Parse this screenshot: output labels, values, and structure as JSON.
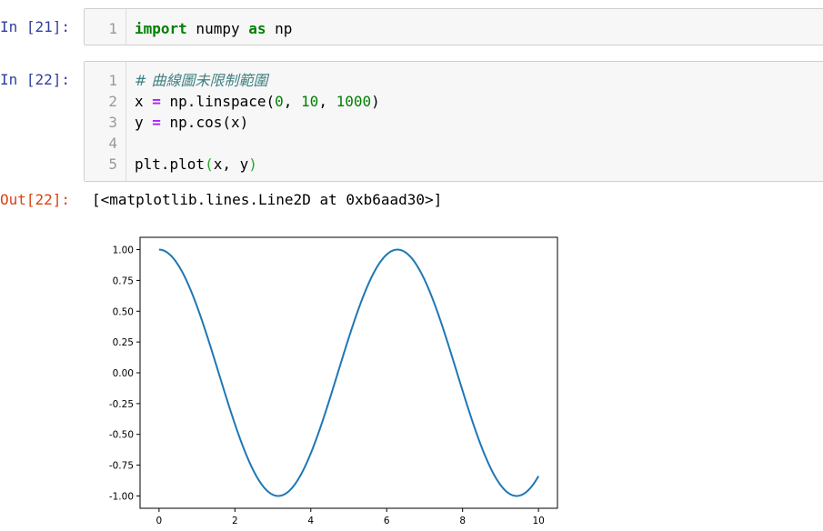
{
  "cells": [
    {
      "prompt": "In [21]:",
      "lines": [
        {
          "n": "1",
          "tokens": [
            {
              "t": "import",
              "c": "kw"
            },
            {
              "t": " numpy ",
              "c": ""
            },
            {
              "t": "as",
              "c": "kw"
            },
            {
              "t": " np",
              "c": ""
            }
          ]
        }
      ]
    },
    {
      "prompt": "In [22]:",
      "lines": [
        {
          "n": "1",
          "tokens": [
            {
              "t": "# 曲線圖未限制範圍",
              "c": "com"
            }
          ]
        },
        {
          "n": "2",
          "tokens": [
            {
              "t": "x ",
              "c": ""
            },
            {
              "t": "=",
              "c": "op"
            },
            {
              "t": " np.linspace(",
              "c": ""
            },
            {
              "t": "0",
              "c": "num"
            },
            {
              "t": ", ",
              "c": ""
            },
            {
              "t": "10",
              "c": "num"
            },
            {
              "t": ", ",
              "c": ""
            },
            {
              "t": "1000",
              "c": "num"
            },
            {
              "t": ")",
              "c": ""
            }
          ]
        },
        {
          "n": "3",
          "tokens": [
            {
              "t": "y ",
              "c": ""
            },
            {
              "t": "=",
              "c": "op"
            },
            {
              "t": " np.cos(x)",
              "c": ""
            }
          ]
        },
        {
          "n": "4",
          "tokens": []
        },
        {
          "n": "5",
          "tokens": [
            {
              "t": "plt.plot",
              "c": ""
            },
            {
              "t": "(",
              "c": "paren-hl"
            },
            {
              "t": "x, y",
              "c": ""
            },
            {
              "t": ")",
              "c": "paren-hl"
            }
          ]
        }
      ]
    }
  ],
  "output": {
    "prompt": "Out[22]:",
    "text": "[<matplotlib.lines.Line2D at 0xb6aad30>]"
  },
  "chart_data": {
    "type": "line",
    "function": "cos",
    "x_range": [
      0,
      10
    ],
    "n_points": 1000,
    "xlim": [
      -0.5,
      10.5
    ],
    "ylim": [
      -1.1,
      1.1
    ],
    "xticks": [
      "0",
      "2",
      "4",
      "6",
      "8",
      "10"
    ],
    "xtick_values": [
      0,
      2,
      4,
      6,
      8,
      10
    ],
    "yticks": [
      "1.00",
      "0.75",
      "0.50",
      "0.25",
      "0.00",
      "-0.25",
      "-0.50",
      "-0.75",
      "-1.00"
    ],
    "ytick_values": [
      1.0,
      0.75,
      0.5,
      0.25,
      0.0,
      -0.25,
      -0.5,
      -0.75,
      -1.0
    ],
    "line_color": "#1f77b4",
    "title": "",
    "xlabel": "",
    "ylabel": ""
  }
}
